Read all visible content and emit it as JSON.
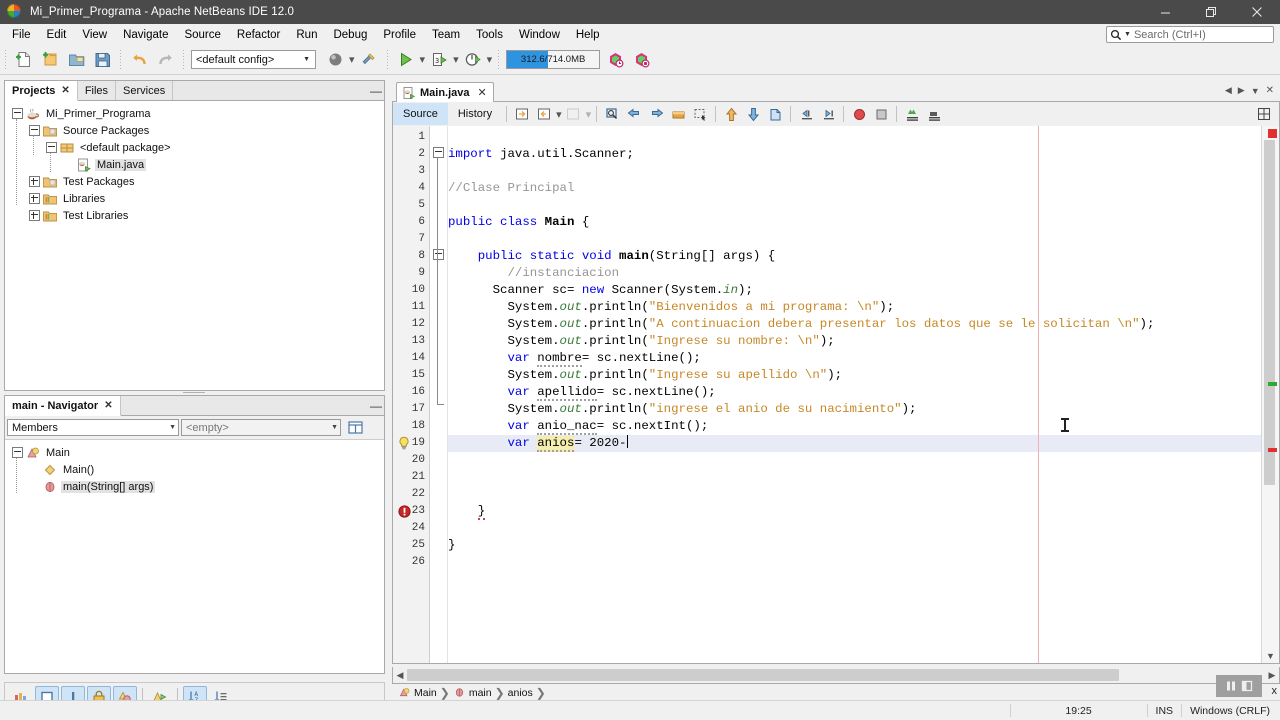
{
  "window": {
    "title": "Mi_Primer_Programa - Apache NetBeans IDE 12.0",
    "icon": "netbeans-logo-icon",
    "minimize": "minimize-button",
    "maximize": "maximize-button",
    "close": "close-button"
  },
  "menubar": {
    "items": [
      {
        "label": "File"
      },
      {
        "label": "Edit"
      },
      {
        "label": "View"
      },
      {
        "label": "Navigate"
      },
      {
        "label": "Source"
      },
      {
        "label": "Refactor"
      },
      {
        "label": "Run"
      },
      {
        "label": "Debug"
      },
      {
        "label": "Profile"
      },
      {
        "label": "Team"
      },
      {
        "label": "Tools"
      },
      {
        "label": "Window"
      },
      {
        "label": "Help"
      }
    ],
    "search": {
      "placeholder": "Search (Ctrl+I)",
      "icon": "search-icon",
      "value": ""
    }
  },
  "toolbar": {
    "buttons": [
      {
        "name": "new-file-button",
        "icon": "new-file-icon"
      },
      {
        "name": "new-project-button",
        "icon": "new-project-icon"
      },
      {
        "name": "open-project-button",
        "icon": "open-project-icon"
      },
      {
        "name": "save-all-button",
        "icon": "save-all-icon"
      },
      {
        "name": "undo-button",
        "icon": "undo-icon"
      },
      {
        "name": "redo-button",
        "icon": "redo-icon"
      }
    ],
    "config": {
      "label": "<default config>",
      "name": "project-config-select"
    },
    "build_button": "build-project-button",
    "clean_build_button": "clean-and-build-button",
    "run_button": "run-project-button",
    "debug_button": "debug-project-button",
    "profile_button": "profile-project-button",
    "memory": {
      "text": "312.6/714.0MB",
      "percent": 44,
      "color": "#2f94e0"
    },
    "gc_buttons": [
      "redo-last-run-icon",
      "stop-build-icon"
    ]
  },
  "projects_panel": {
    "tabs": [
      {
        "label": "Projects",
        "active": true,
        "closable": true
      },
      {
        "label": "Files",
        "active": false,
        "closable": false
      },
      {
        "label": "Services",
        "active": false,
        "closable": false
      }
    ],
    "minimize": "minimize-panel-button",
    "tree": [
      {
        "label": "Mi_Primer_Programa",
        "icon": "java-project-icon",
        "depth": 0,
        "expander": "minus",
        "selected": false
      },
      {
        "label": "Source Packages",
        "icon": "source-packages-icon",
        "depth": 1,
        "expander": "minus",
        "selected": false
      },
      {
        "label": "<default package>",
        "icon": "package-icon",
        "depth": 2,
        "expander": "minus",
        "selected": false
      },
      {
        "label": "Main.java",
        "icon": "java-main-file-icon",
        "depth": 3,
        "expander": "none",
        "selected": true
      },
      {
        "label": "Test Packages",
        "icon": "test-packages-icon",
        "depth": 1,
        "expander": "plus",
        "selected": false
      },
      {
        "label": "Libraries",
        "icon": "libraries-icon",
        "depth": 1,
        "expander": "plus",
        "selected": false
      },
      {
        "label": "Test Libraries",
        "icon": "test-libraries-icon",
        "depth": 1,
        "expander": "plus",
        "selected": false
      }
    ]
  },
  "navigator_panel": {
    "tab": {
      "label": "main - Navigator",
      "closable": true
    },
    "minimize": "minimize-panel-button",
    "scope_select": {
      "value": "Members",
      "name": "navigator-scope-select"
    },
    "filter_select": {
      "value": "<empty>",
      "name": "navigator-filter-select"
    },
    "view_button": "navigator-view-icon",
    "tree": [
      {
        "label": "Main",
        "icon": "class-icon",
        "depth": 0,
        "expander": "minus",
        "selected": false
      },
      {
        "label": "Main()",
        "icon": "constructor-icon",
        "depth": 1,
        "expander": "none",
        "selected": false
      },
      {
        "label": "main(String[] args)",
        "icon": "method-icon",
        "depth": 1,
        "expander": "none",
        "selected": true
      }
    ],
    "bottom_tools": [
      {
        "name": "filters-icon",
        "active": false
      },
      {
        "name": "show-non-public-icon",
        "active": true
      },
      {
        "name": "show-static-icon",
        "active": true
      },
      {
        "name": "show-fields-icon",
        "active": true
      },
      {
        "name": "show-inherited-icon",
        "active": true
      },
      {
        "name": "show-inner-classes-icon",
        "active": false
      },
      {
        "name": "sort-alphabetically-icon",
        "active": true
      },
      {
        "name": "sort-by-source-icon",
        "active": false
      }
    ]
  },
  "editor": {
    "tab": {
      "label": "Main.java",
      "icon": "java-file-icon",
      "closable": true
    },
    "view_tabs": [
      {
        "label": "Source",
        "active": true
      },
      {
        "label": "History",
        "active": false
      }
    ],
    "toolbar_icons": [
      "last-edit-icon",
      "back-icon",
      "forward-icon",
      "find-selection-icon",
      "previous-bookmark-icon",
      "next-bookmark-icon",
      "toggle-bookmark-icon",
      "toggle-rectangular-selection-icon",
      "previous-error-icon",
      "next-error-icon",
      "toggle-highlight-icon",
      "shift-left-icon",
      "shift-right-icon",
      "start-macro-recording-icon",
      "stop-macro-recording-icon",
      "comment-icon",
      "uncomment-icon"
    ],
    "maximize_icon": "maximize-editor-icon",
    "nav_prev_icon": "scroll-tab-left-icon",
    "nav_next_icon": "scroll-tab-right-icon",
    "tab_list_icon": "tab-list-icon",
    "close_tab_icon": "close-document-icon",
    "first_line": 1,
    "total_lines": 26,
    "current_line": 19,
    "error_line": 23,
    "hint_line": 19,
    "lines": [
      {
        "n": 1,
        "tokens": []
      },
      {
        "n": 2,
        "indent": 0,
        "tokens": [
          {
            "t": "import ",
            "c": "k"
          },
          {
            "t": "java.util.Scanner;",
            "c": ""
          }
        ]
      },
      {
        "n": 3,
        "tokens": []
      },
      {
        "n": 4,
        "indent": 0,
        "tokens": [
          {
            "t": "//Clase Principal",
            "c": "cm"
          }
        ]
      },
      {
        "n": 5,
        "tokens": []
      },
      {
        "n": 6,
        "indent": 0,
        "tokens": [
          {
            "t": "public class ",
            "c": "k"
          },
          {
            "t": "Main",
            "c": "kb"
          },
          {
            "t": " {",
            "c": ""
          }
        ]
      },
      {
        "n": 7,
        "tokens": []
      },
      {
        "n": 8,
        "indent": 1,
        "tokens": [
          {
            "t": "public static void ",
            "c": "k"
          },
          {
            "t": "main",
            "c": "kb"
          },
          {
            "t": "(String[] args) {",
            "c": ""
          }
        ]
      },
      {
        "n": 9,
        "indent": 2,
        "tokens": [
          {
            "t": "//instanciacion",
            "c": "cm"
          }
        ]
      },
      {
        "n": 10,
        "indent": 1,
        "tokens": [
          {
            "t": "  Scanner sc= ",
            "c": ""
          },
          {
            "t": "new ",
            "c": "k"
          },
          {
            "t": "Scanner(System.",
            "c": ""
          },
          {
            "t": "in",
            "c": "fld"
          },
          {
            "t": ");",
            "c": ""
          }
        ]
      },
      {
        "n": 11,
        "indent": 2,
        "tokens": [
          {
            "t": "System.",
            "c": ""
          },
          {
            "t": "out",
            "c": "fld"
          },
          {
            "t": ".println(",
            "c": ""
          },
          {
            "t": "\"Bienvenidos a mi programa: \\n\"",
            "c": "st"
          },
          {
            "t": ");",
            "c": ""
          }
        ]
      },
      {
        "n": 12,
        "indent": 2,
        "tokens": [
          {
            "t": "System.",
            "c": ""
          },
          {
            "t": "out",
            "c": "fld"
          },
          {
            "t": ".println(",
            "c": ""
          },
          {
            "t": "\"A continuacion debera presentar los datos que se le solicitan \\n\"",
            "c": "st"
          },
          {
            "t": ");",
            "c": ""
          }
        ]
      },
      {
        "n": 13,
        "indent": 2,
        "tokens": [
          {
            "t": "System.",
            "c": ""
          },
          {
            "t": "out",
            "c": "fld"
          },
          {
            "t": ".println(",
            "c": ""
          },
          {
            "t": "\"Ingrese su nombre: \\n\"",
            "c": "st"
          },
          {
            "t": ");",
            "c": ""
          }
        ]
      },
      {
        "n": 14,
        "indent": 2,
        "tokens": [
          {
            "t": "var ",
            "c": "k"
          },
          {
            "t": "nombre",
            "c": "sq"
          },
          {
            "t": "= sc.nextLine();",
            "c": ""
          }
        ]
      },
      {
        "n": 15,
        "indent": 2,
        "tokens": [
          {
            "t": "System.",
            "c": ""
          },
          {
            "t": "out",
            "c": "fld"
          },
          {
            "t": ".println(",
            "c": ""
          },
          {
            "t": "\"Ingrese su apellido \\n\"",
            "c": "st"
          },
          {
            "t": ");",
            "c": ""
          }
        ]
      },
      {
        "n": 16,
        "indent": 2,
        "tokens": [
          {
            "t": "var ",
            "c": "k"
          },
          {
            "t": "apellido",
            "c": "sq"
          },
          {
            "t": "= sc.nextLine();",
            "c": ""
          }
        ]
      },
      {
        "n": 17,
        "indent": 2,
        "tokens": [
          {
            "t": "System.",
            "c": ""
          },
          {
            "t": "out",
            "c": "fld"
          },
          {
            "t": ".println(",
            "c": ""
          },
          {
            "t": "\"ingrese el anio de su nacimiento\"",
            "c": "st"
          },
          {
            "t": ");",
            "c": ""
          }
        ]
      },
      {
        "n": 18,
        "indent": 2,
        "tokens": [
          {
            "t": "var ",
            "c": "k"
          },
          {
            "t": "anio_nac",
            "c": "sq"
          },
          {
            "t": "= sc.nextInt();",
            "c": ""
          }
        ]
      },
      {
        "n": 19,
        "indent": 2,
        "tokens": [
          {
            "t": "var ",
            "c": "k"
          },
          {
            "t": "anios",
            "c": "hl sq"
          },
          {
            "t": "= 2020-",
            "c": ""
          }
        ],
        "caret": true
      },
      {
        "n": 20,
        "tokens": []
      },
      {
        "n": 21,
        "tokens": []
      },
      {
        "n": 22,
        "tokens": []
      },
      {
        "n": 23,
        "indent": 1,
        "tokens": [
          {
            "t": "}",
            "c": "sqr"
          }
        ]
      },
      {
        "n": 24,
        "tokens": []
      },
      {
        "n": 25,
        "indent": 0,
        "tokens": [
          {
            "t": "}",
            "c": ""
          }
        ]
      },
      {
        "n": 26,
        "tokens": []
      }
    ],
    "error_markers": [
      {
        "top_pct": 0.5,
        "color": "#d83b3b",
        "name": "error-overview-marker"
      },
      {
        "top_pct": 47.0,
        "color": "#2eab2e",
        "name": "occurrence-overview-marker"
      },
      {
        "top_pct": 58.5,
        "color": "#d83b3b",
        "name": "error-line-marker"
      }
    ]
  },
  "breadcrumb": {
    "items": [
      {
        "label": "Main",
        "icon": "class-icon"
      },
      {
        "label": "main",
        "icon": "method-icon"
      },
      {
        "label": "anios",
        "icon": ""
      }
    ]
  },
  "statusbar": {
    "time": "19:25",
    "insert_mode": "INS",
    "line_ending": "Windows (CRLF)"
  },
  "float_toolbar": {
    "pause_icon": "pause-icon",
    "dock_icon": "dock-icon",
    "close_label": "x"
  }
}
